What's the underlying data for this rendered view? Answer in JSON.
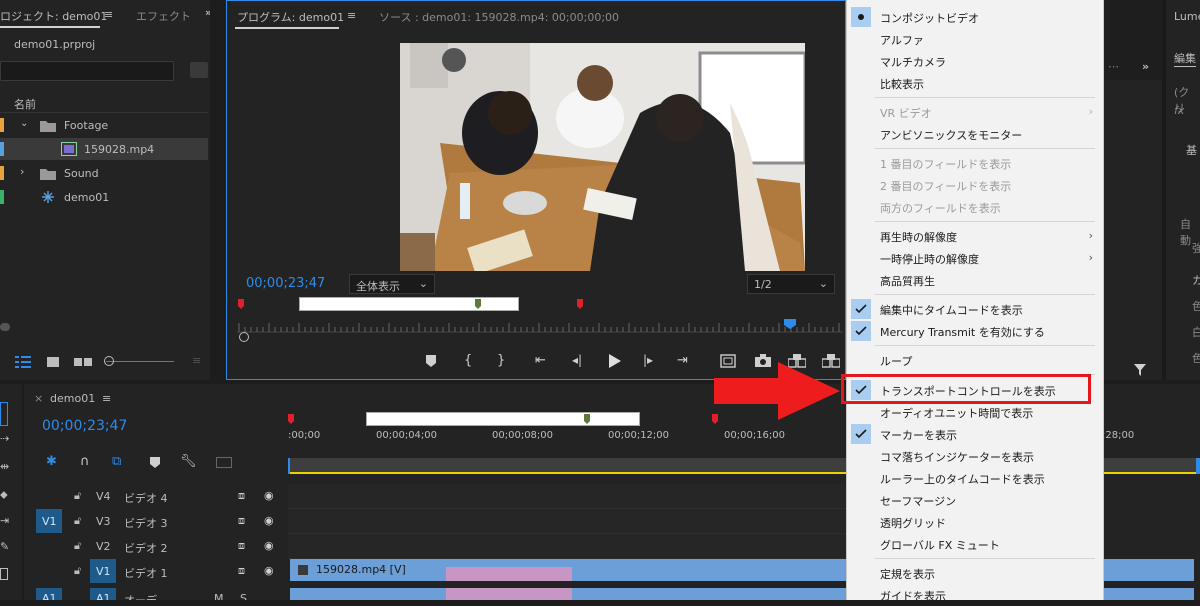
{
  "project_panel": {
    "tab_project": "ロジェクト: demo01",
    "tab_effects": "エフェクト",
    "file_name": "demo01.prproj",
    "column_name": "名前",
    "items": [
      {
        "label": "Footage",
        "color": "#e8a33a"
      },
      {
        "label": "159028.mp4",
        "color": "#5aa0e0"
      },
      {
        "label": "Sound",
        "color": "#e8a33a"
      },
      {
        "label": "demo01",
        "color": "#3ab36a"
      }
    ]
  },
  "program_monitor": {
    "tab_program": "プログラム: demo01",
    "tab_source": "ソース : demo01: 159028.mp4: 00;00;00;00",
    "timecode": "00;00;23;47",
    "zoom_select": "全体表示",
    "resolution_select": "1/2"
  },
  "right_panel": {
    "tab_lumetri": "Lume",
    "tab_edit": "編集",
    "row1": "(クリ",
    "row2": "fx",
    "row3": "基",
    "row4": "自動",
    "row5": "強",
    "row6": "カ",
    "row7": "色",
    "row8": "白",
    "row9": "色"
  },
  "context_menu": {
    "items": [
      {
        "label": "コンポジットビデオ",
        "state": "dot"
      },
      {
        "label": "アルファ"
      },
      {
        "label": "マルチカメラ"
      },
      {
        "label": "比較表示"
      },
      {
        "label": "VR ビデオ",
        "disabled": true,
        "submenu": true
      },
      {
        "label": "アンビソニックスをモニター"
      },
      {
        "label": "1 番目のフィールドを表示",
        "disabled": true
      },
      {
        "label": "2 番目のフィールドを表示",
        "disabled": true
      },
      {
        "label": "両方のフィールドを表示",
        "disabled": true
      },
      {
        "label": "再生時の解像度",
        "submenu": true
      },
      {
        "label": "一時停止時の解像度",
        "submenu": true
      },
      {
        "label": "高品質再生"
      },
      {
        "label": "編集中にタイムコードを表示",
        "state": "check"
      },
      {
        "label": "Mercury Transmit を有効にする",
        "state": "check"
      },
      {
        "label": "ループ"
      },
      {
        "label": "トランスポートコントロールを表示",
        "state": "check"
      },
      {
        "label": "オーディオユニット時間で表示"
      },
      {
        "label": "マーカーを表示",
        "state": "check"
      },
      {
        "label": "コマ落ちインジケーターを表示"
      },
      {
        "label": "ルーラー上のタイムコードを表示"
      },
      {
        "label": "セーフマージン"
      },
      {
        "label": "透明グリッド"
      },
      {
        "label": "グローバル FX ミュート"
      },
      {
        "label": "定規を表示"
      },
      {
        "label": "ガイドを表示"
      }
    ]
  },
  "timeline": {
    "tab": "demo01",
    "timecode": "00;00;23;47",
    "ruler": [
      ":00;00",
      "00;00;04;00",
      "00;00;08;00",
      "00;00;12;00",
      "00;00;16;00",
      ";28;00"
    ],
    "tracks": [
      {
        "src": "",
        "id": "V4",
        "name": "ビデオ 4"
      },
      {
        "src": "V1",
        "id": "V3",
        "name": "ビデオ 3"
      },
      {
        "src": "",
        "id": "V2",
        "name": "ビデオ 2"
      },
      {
        "src": "",
        "id": "V1",
        "name": "ビデオ 1"
      }
    ],
    "audio_src": "A1",
    "audio_id": "A1",
    "audio_name": "オーデ",
    "audio_m": "M",
    "audio_s": "S",
    "clip_label": "159028.mp4 [V]"
  }
}
